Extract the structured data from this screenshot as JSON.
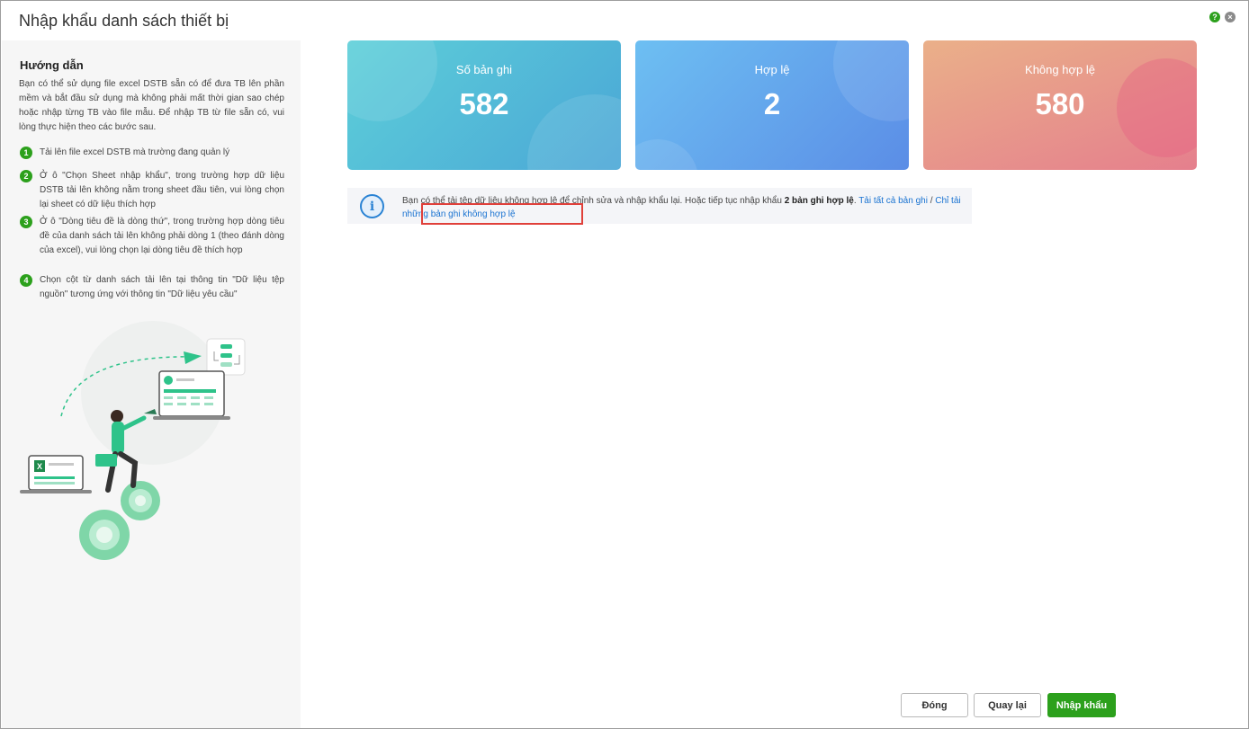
{
  "dialog": {
    "title": "Nhập khẩu danh sách thiết bị",
    "help_icon": "?",
    "close_icon": "×"
  },
  "sidebar": {
    "guide_title": "Hướng dẫn",
    "intro": "Bạn có thể sử dụng file excel DSTB sẵn có để đưa TB lên phần mềm và bắt đầu sử dụng mà không phải mất thời gian sao chép hoặc nhập từng TB vào file mẫu. Để nhập TB từ file sẵn có, vui lòng thực hiện theo các bước sau.",
    "steps": [
      {
        "num": "1",
        "text": "Tải lên file excel DSTB mà trường đang quản lý"
      },
      {
        "num": "2",
        "text": "Ở ô \"Chọn Sheet nhập khẩu\", trong trường hợp dữ liệu DSTB tải lên không nằm trong sheet đầu tiên, vui lòng chọn lại sheet có dữ liệu thích hợp"
      },
      {
        "num": "3",
        "text": "Ở ô \"Dòng tiêu đề là dòng thứ\", trong trường hợp dòng tiêu đề của danh sách tải lên không phải dòng 1 (theo đánh dòng của excel), vui lòng chọn lại dòng tiêu đề thích hợp"
      },
      {
        "num": "4",
        "text": "Chọn cột từ danh sách tải lên tại thông tin \"Dữ liệu tệp nguồn\" tương ứng với thông tin \"Dữ liệu yêu cầu\""
      }
    ],
    "excel_badge": "X"
  },
  "cards": {
    "total": {
      "label": "Số bản ghi",
      "value": "582"
    },
    "valid": {
      "label": "Hợp lệ",
      "value": "2"
    },
    "invalid": {
      "label": "Không hợp lệ",
      "value": "580"
    }
  },
  "info": {
    "icon": "i",
    "text_before": "Bạn có thể tải tệp dữ liệu không hợp lệ để chỉnh sửa và nhập khẩu lại. Hoặc tiếp tục nhập khẩu ",
    "bold_count": "2 bản ghi hợp lệ",
    "text_after": ". ",
    "link_all": "Tải tất cả bản ghi",
    "separator": " / ",
    "link_invalid": "Chỉ tải những bản ghi không hợp lệ"
  },
  "footer": {
    "close_label": "Đóng",
    "back_label": "Quay lại",
    "import_label": "Nhập khẩu"
  },
  "colors": {
    "primary_green": "#2ca01c",
    "link_blue": "#1a73d1",
    "highlight_red": "#e0403a"
  }
}
